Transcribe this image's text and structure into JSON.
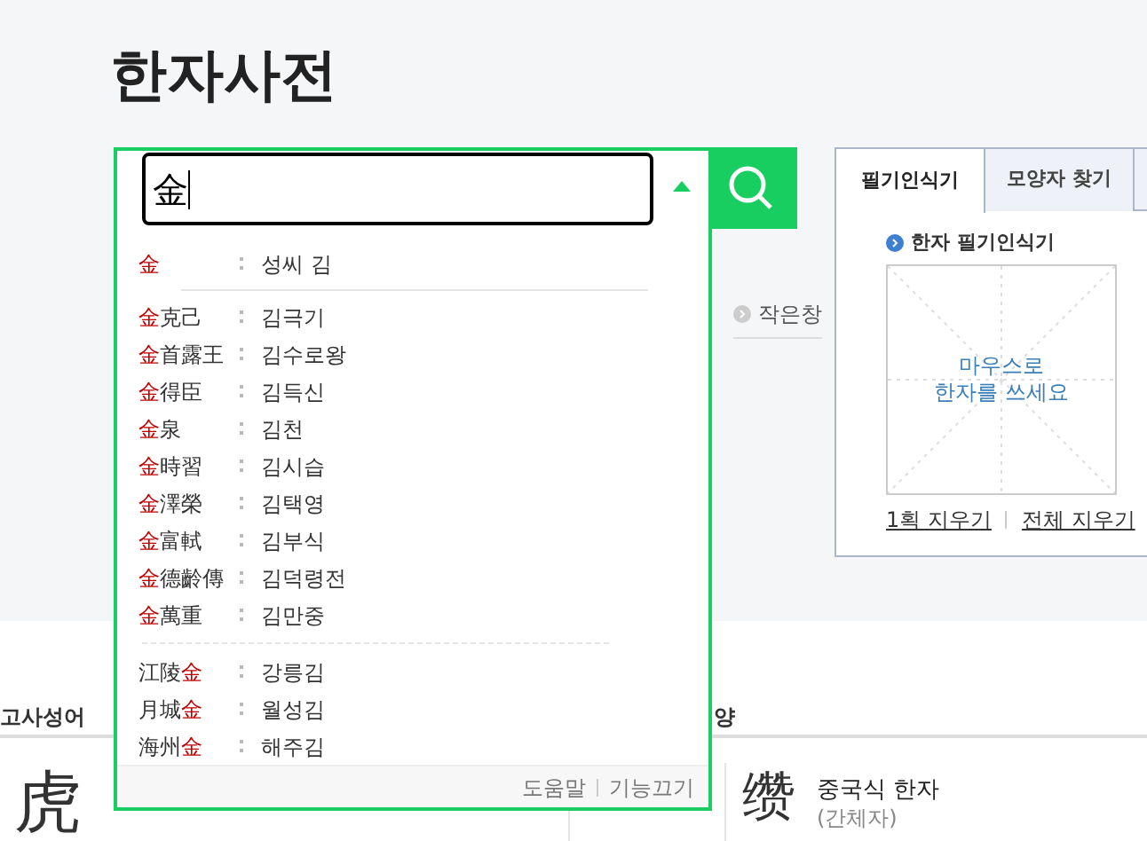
{
  "title": "한자사전",
  "search": {
    "value": "金"
  },
  "suggestions": [
    [
      {
        "match": "金",
        "reading": "성씨 김"
      }
    ],
    [
      {
        "match": "金",
        "suffix": "克己",
        "reading": "김극기"
      },
      {
        "match": "金",
        "suffix": "首露王",
        "reading": "김수로왕"
      },
      {
        "match": "金",
        "suffix": "得臣",
        "reading": "김득신"
      },
      {
        "match": "金",
        "suffix": "泉",
        "reading": "김천"
      },
      {
        "match": "金",
        "suffix": "時習",
        "reading": "김시습"
      },
      {
        "match": "金",
        "suffix": "澤榮",
        "reading": "김택영"
      },
      {
        "match": "金",
        "suffix": "富軾",
        "reading": "김부식"
      },
      {
        "match": "金",
        "suffix": "德齡傳",
        "reading": "김덕령전"
      },
      {
        "match": "金",
        "suffix": "萬重",
        "reading": "김만중"
      }
    ],
    [
      {
        "prefix": "江陵",
        "match": "金",
        "reading": "강릉김"
      },
      {
        "prefix": "月城",
        "match": "金",
        "reading": "월성김"
      },
      {
        "prefix": "海州",
        "match": "金",
        "reading": "해주김"
      }
    ]
  ],
  "footer_links": [
    "도움말",
    "기능끄기"
  ],
  "side_link": "작은창",
  "handwriting": {
    "tabs": [
      {
        "label": "필기인식기",
        "selected": true
      },
      {
        "label": "모양자 찾기",
        "selected": false
      }
    ],
    "heading": "한자 필기인식기",
    "hint": [
      "마우스로",
      "한자를 쓰세요"
    ],
    "actions": [
      "1획 지우기",
      "전체 지우기"
    ]
  },
  "sections": [
    "고사성어",
    "양"
  ],
  "idiom": {
    "hanja": "虎"
  },
  "chinese_char": {
    "simplified": "缵",
    "label": "중국식 한자",
    "sublabel": "(간체자)"
  }
}
